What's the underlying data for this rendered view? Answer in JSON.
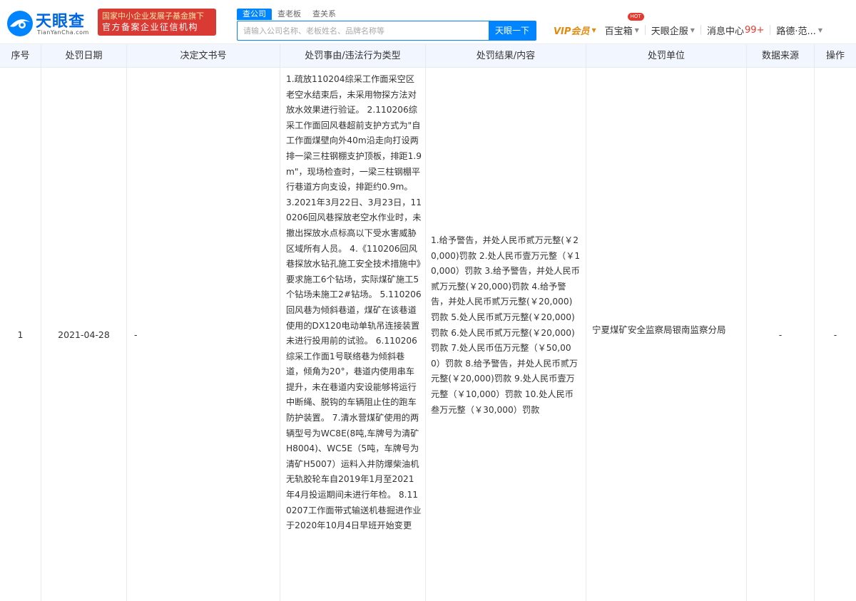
{
  "header": {
    "logo_cn": "天眼查",
    "logo_en": "TianYanCha.com",
    "badge_line1": "国家中小企业发展子基金旗下",
    "badge_line2": "官方备案企业征信机构",
    "search_tabs": [
      "查公司",
      "查老板",
      "查关系"
    ],
    "search_placeholder": "请输入公司名称、老板姓名、品牌名称等",
    "search_button": "天眼一下",
    "nav": {
      "vip": "VIP会员",
      "baibaoxiang": "百宝箱",
      "hot": "HOT",
      "qifu": "天眼企服",
      "message": "消息中心",
      "message_count": "99+",
      "user": "路德·范..."
    },
    "colors": {
      "brand": "#0084ff",
      "badge": "#d93a33",
      "vip": "#e28a10",
      "header_bg": "#f1f6ff"
    }
  },
  "table": {
    "columns": [
      "序号",
      "处罚日期",
      "决定文书号",
      "处罚事由/违法行为类型",
      "处罚结果/内容",
      "处罚单位",
      "数据来源",
      "操作"
    ],
    "rows": [
      {
        "index": "1",
        "date": "2021-04-28",
        "doc_no": "-",
        "reason": "1.疏放110204综采工作面采空区老空水结束后，未采用物探方法对放水效果进行验证。 2.110206综采工作面回风巷超前支护方式为\"自工作面煤壁向外40m沿走向打设两排一梁三柱钢棚支护顶板，排距1.9m\"，现场检查时，一梁三柱钢棚平行巷道方向支设，排距约0.9m。 3.2021年3月22日、3月23日，110206回风巷探放老空水作业时，未撤出探放水点标高以下受水害威胁区域所有人员。 4.《110206回风巷探放水钻孔施工安全技术措施中》要求施工6个钻场，实际煤矿施工5个钻场未施工2#钻场。 5.110206回风巷为倾斜巷道，煤矿在该巷道使用的DX120电动单轨吊连接装置未进行投用前的试验。 6.110206综采工作面1号联络巷为倾斜巷道，倾角为20°，巷道内使用串车提升，未在巷道内安设能够将运行中断绳、脱钩的车辆阻止住的跑车防护装置。 7.清水营煤矿使用的两辆型号为WC8E(8吨,车牌号为清矿H8004)、WC5E（5吨，车牌号为清矿H5007）运料入井防爆柴油机无轨胶轮车自2019年1月至2021年4月投运期间未进行年检。 8.110207工作面带式输送机巷掘进作业于2020年10月4日早班开始变更",
        "result": "1.给予警告，并处人民币贰万元整(￥20,000)罚款 2.处人民币壹万元整（￥10,000）罚款 3.给予警告，并处人民币贰万元整(￥20,000)罚款 4.给予警告，并处人民币贰万元整(￥20,000)罚款 5.处人民币贰万元整(￥20,000)罚款 6.处人民币贰万元整(￥20,000)罚款 7.处人民币伍万元整（￥50,000）罚款 8.给予警告，并处人民币贰万元整(￥20,000)罚款 9.处人民币壹万元整（￥10,000）罚款 10.处人民币叁万元整（￥30,000）罚款",
        "unit": "宁夏煤矿安全监察局银南监察分局",
        "source": "-",
        "action": "-"
      }
    ]
  }
}
